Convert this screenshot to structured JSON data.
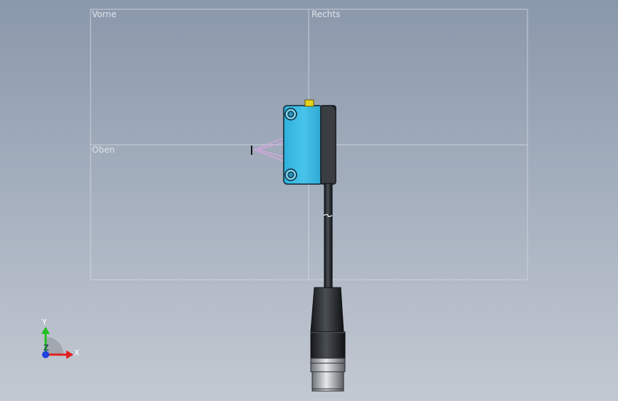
{
  "viewport": {
    "planes": {
      "front": "Vorne",
      "right": "Rechts",
      "top": "Oben"
    }
  },
  "triad": {
    "x_label": "X",
    "y_label": "Y",
    "z_label": "Z",
    "x_color": "#e02020",
    "y_color": "#20c020",
    "z_color": "#2040e0"
  },
  "model": {
    "sensor_color": "#35b8e0",
    "cable_color": "#2a2d31",
    "beam_color": "#e2a6e8",
    "led_color": "#e8d020"
  }
}
